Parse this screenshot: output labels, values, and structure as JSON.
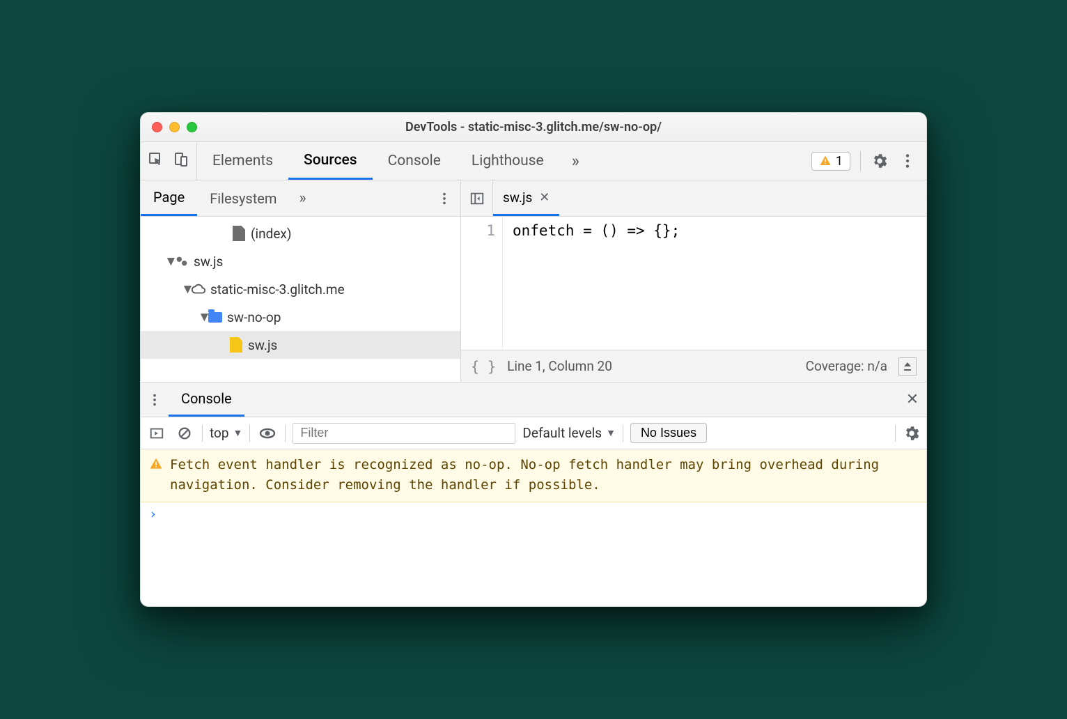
{
  "window": {
    "title": "DevTools - static-misc-3.glitch.me/sw-no-op/"
  },
  "main_tabs": {
    "items": [
      "Elements",
      "Sources",
      "Console",
      "Lighthouse"
    ],
    "active": "Sources",
    "overflow_glyph": "»",
    "warning_count": "1"
  },
  "sources": {
    "left_tabs": {
      "items": [
        "Page",
        "Filesystem"
      ],
      "active": "Page",
      "overflow_glyph": "»"
    },
    "tree": {
      "row0_label": "(index)",
      "row1_label": "sw.js",
      "row2_label": "static-misc-3.glitch.me",
      "row3_label": "sw-no-op",
      "row4_label": "sw.js"
    },
    "open_file": {
      "name": "sw.js"
    },
    "code": {
      "line_numbers": [
        "1"
      ],
      "lines": [
        "onfetch = () => {};"
      ]
    },
    "status": {
      "braces": "{ }",
      "position": "Line 1, Column 20",
      "coverage": "Coverage: n/a"
    }
  },
  "drawer": {
    "tab": "Console"
  },
  "console": {
    "context": "top",
    "filter_placeholder": "Filter",
    "levels_label": "Default levels",
    "issues_label": "No Issues",
    "warning_text": "Fetch event handler is recognized as no-op. No-op fetch handler may bring overhead during navigation. Consider removing the handler if possible.",
    "prompt": "›"
  }
}
